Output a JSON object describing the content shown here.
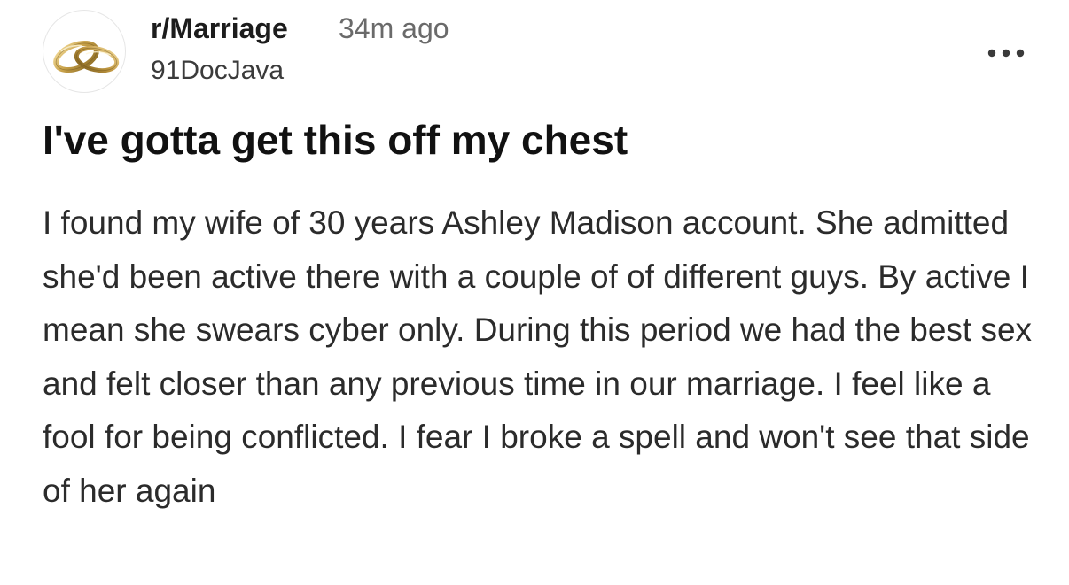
{
  "post": {
    "avatar_icon": "wedding-rings-icon",
    "subreddit": "r/Marriage",
    "time_ago": "34m ago",
    "username": "91DocJava",
    "more_icon": "more-options-icon",
    "title": "I've gotta get this off my chest",
    "body": "I found my wife of 30 years Ashley Madison account. She admitted she'd been active there with a couple of of different guys. By active I mean she swears cyber only. During this period we had the best sex and felt closer than any previous time in our marriage. I feel like a fool for being conflicted. I fear I broke a spell and won't see that side of her again"
  },
  "colors": {
    "background": "#ffffff",
    "text_primary": "#1c1c1c",
    "text_secondary": "#6a6a6a",
    "ring_gold": "#c9a24a"
  }
}
